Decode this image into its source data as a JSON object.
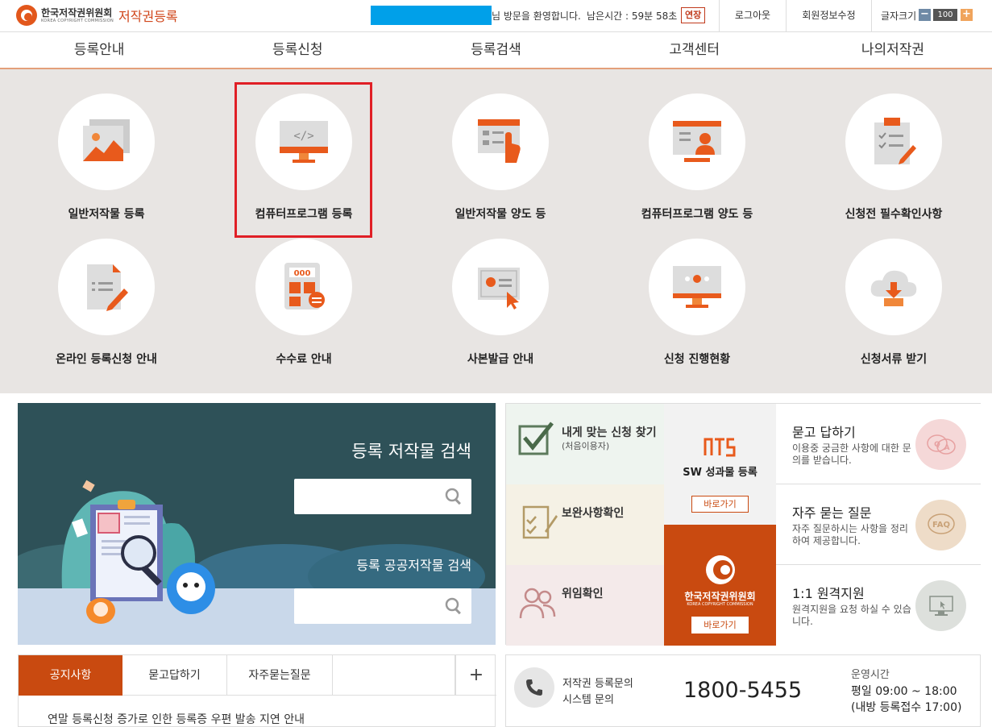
{
  "header": {
    "org_name": "한국저작권위원회",
    "org_en": "KOREA COPYRIGHT COMMISSION",
    "service_name": "저작권등록",
    "welcome": "님 방문을 환영합니다.",
    "time_left": "남은시간 : 59분 58초",
    "extend": "연장",
    "logout": "로그아웃",
    "edit_info": "회원정보수정",
    "font_size_label": "글자크기",
    "font_size_value": "100",
    "minus": "−",
    "plus": "+"
  },
  "nav": [
    "등록안내",
    "등록신청",
    "등록검색",
    "고객센터",
    "나의저작권"
  ],
  "services": [
    {
      "label": "일반저작물 등록",
      "icon": "image-gallery-icon"
    },
    {
      "label": "컴퓨터프로그램 등록",
      "icon": "code-monitor-icon",
      "highlighted": true
    },
    {
      "label": "일반저작물 양도 등",
      "icon": "click-form-icon"
    },
    {
      "label": "컴퓨터프로그램 양도 등",
      "icon": "person-monitor-icon"
    },
    {
      "label": "신청전 필수확인사항",
      "icon": "checklist-icon"
    },
    {
      "label": "온라인 등록신청 안내",
      "icon": "document-edit-icon"
    },
    {
      "label": "수수료 안내",
      "icon": "calculator-icon"
    },
    {
      "label": "사본발급 안내",
      "icon": "certificate-icon"
    },
    {
      "label": "신청 진행현황",
      "icon": "progress-monitor-icon"
    },
    {
      "label": "신청서류 받기",
      "icon": "cloud-download-icon"
    }
  ],
  "search": {
    "title": "등록 저작물 검색",
    "public_title": "등록 공공저작물 검색"
  },
  "quick": {
    "find_title": "내게 맞는 신청 찾기",
    "find_sub": "(처음이용자)",
    "supplement": "보완사항확인",
    "delegation": "위임확인",
    "sw_title": "SW 성과물 등록",
    "go": "바로가기",
    "kcc_name": "한국저작권위원회",
    "kcc_en": "KOREA COPYRIGHT COMMISSION"
  },
  "faq": [
    {
      "title": "묻고 답하기",
      "desc": "이용중 궁금한 사항에 대한 문의를 받습니다.",
      "icon": "qa-icon",
      "badge": "Q A",
      "color": "#f5d8d8"
    },
    {
      "title": "자주 묻는 질문",
      "desc": "자주 질문하시는 사항을 정리하여 제공합니다.",
      "icon": "faq-icon",
      "badge": "FAQ",
      "color": "#eedcc8"
    },
    {
      "title": "1:1 원격지원",
      "desc": "원격지원을 요청 하실 수 있습니다.",
      "icon": "remote-support-icon",
      "badge": "",
      "color": "#dde0dc"
    }
  ],
  "notice": {
    "tabs": [
      "공지사항",
      "묻고답하기",
      "자주묻는질문"
    ],
    "more": "+",
    "first_item": "연말 등록신청 증가로 인한 등록증 우편 발송 지연 안내"
  },
  "contact": {
    "label1": "저작권 등록문의",
    "label2": "시스템 문의",
    "phone": "1800-5455",
    "hours_title": "운영시간",
    "hours": "평일 09:00 ~ 18:00",
    "hours_note": "(내방 등록접수 17:00)"
  },
  "colors": {
    "accent": "#e2571c",
    "highlight": "#e01f26",
    "search_bg": "#2e5158",
    "kcc_bg": "#c94a10"
  }
}
